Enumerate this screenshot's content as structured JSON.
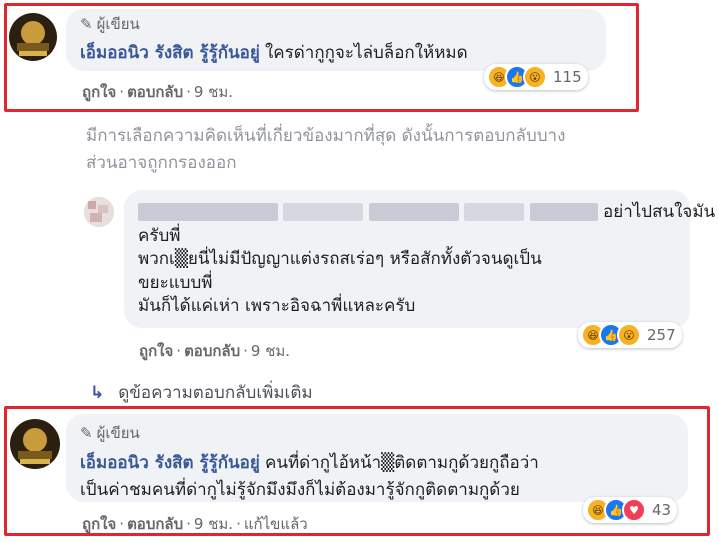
{
  "comment1": {
    "badge": "ผู้เขียน",
    "name": "เอ็มออนิว รังสิต รู้รู้กันอยู่",
    "text": "ใครด่ากูกูจะไล่บล็อกให้หมด",
    "actions": {
      "like": "ถูกใจ",
      "reply": "ตอบกลับ",
      "time": "9 ชม."
    },
    "reactions": {
      "icons": [
        "haha-icon",
        "like-icon",
        "wow-icon"
      ],
      "count": "115"
    }
  },
  "filter_notice": {
    "line1": "มีการเลือกความคิดเห็นที่เกี่ยวข้องมากที่สุด ดังนั้นการตอบกลับบาง",
    "line2": "ส่วนอาจถูกกรองออก"
  },
  "reply": {
    "line1_tail": "อย่าไปสนใจมัน",
    "line2": "ครับพี่",
    "line3": "พวกเ▒ยนี่ไม่มีปัญญาแต่งรถสเร่อๆ หรือสักทั้งตัวจนดูเป็น",
    "line4": "ขยะแบบพี่",
    "line5": "มันก็ได้แค่เห่า เพราะอิจฉาพี่แหละครับ",
    "actions": {
      "like": "ถูกใจ",
      "reply": "ตอบกลับ",
      "time": "9 ชม."
    },
    "reactions": {
      "icons": [
        "haha-icon",
        "like-icon",
        "wow-icon"
      ],
      "count": "257"
    }
  },
  "more_replies": "ดูข้อความตอบกลับเพิ่มเติม",
  "comment2": {
    "badge": "ผู้เขียน",
    "name": "เอ็มออนิว รังสิต รู้รู้กันอยู่",
    "text_line1": "คนที่ด่ากูไอ้หน้า▒ติดตามกูด้วยกูถือว่า",
    "text_line2": "เป็นค่าชมคนที่ด่ากูไม่รู้จักมึงมึงก็ไม่ต้องมารู้จักกูติดตามกูด้วย",
    "actions": {
      "like": "ถูกใจ",
      "reply": "ตอบกลับ",
      "time": "9 ชม.",
      "edited": "แก้ไขแล้ว"
    },
    "reactions": {
      "icons": [
        "haha-icon",
        "like-icon",
        "love-icon"
      ],
      "count": "43"
    }
  },
  "colors": {
    "highlight_box": "#e0262e",
    "name": "#385898",
    "bubble": "#f0f2f5",
    "meta": "#65676b"
  }
}
